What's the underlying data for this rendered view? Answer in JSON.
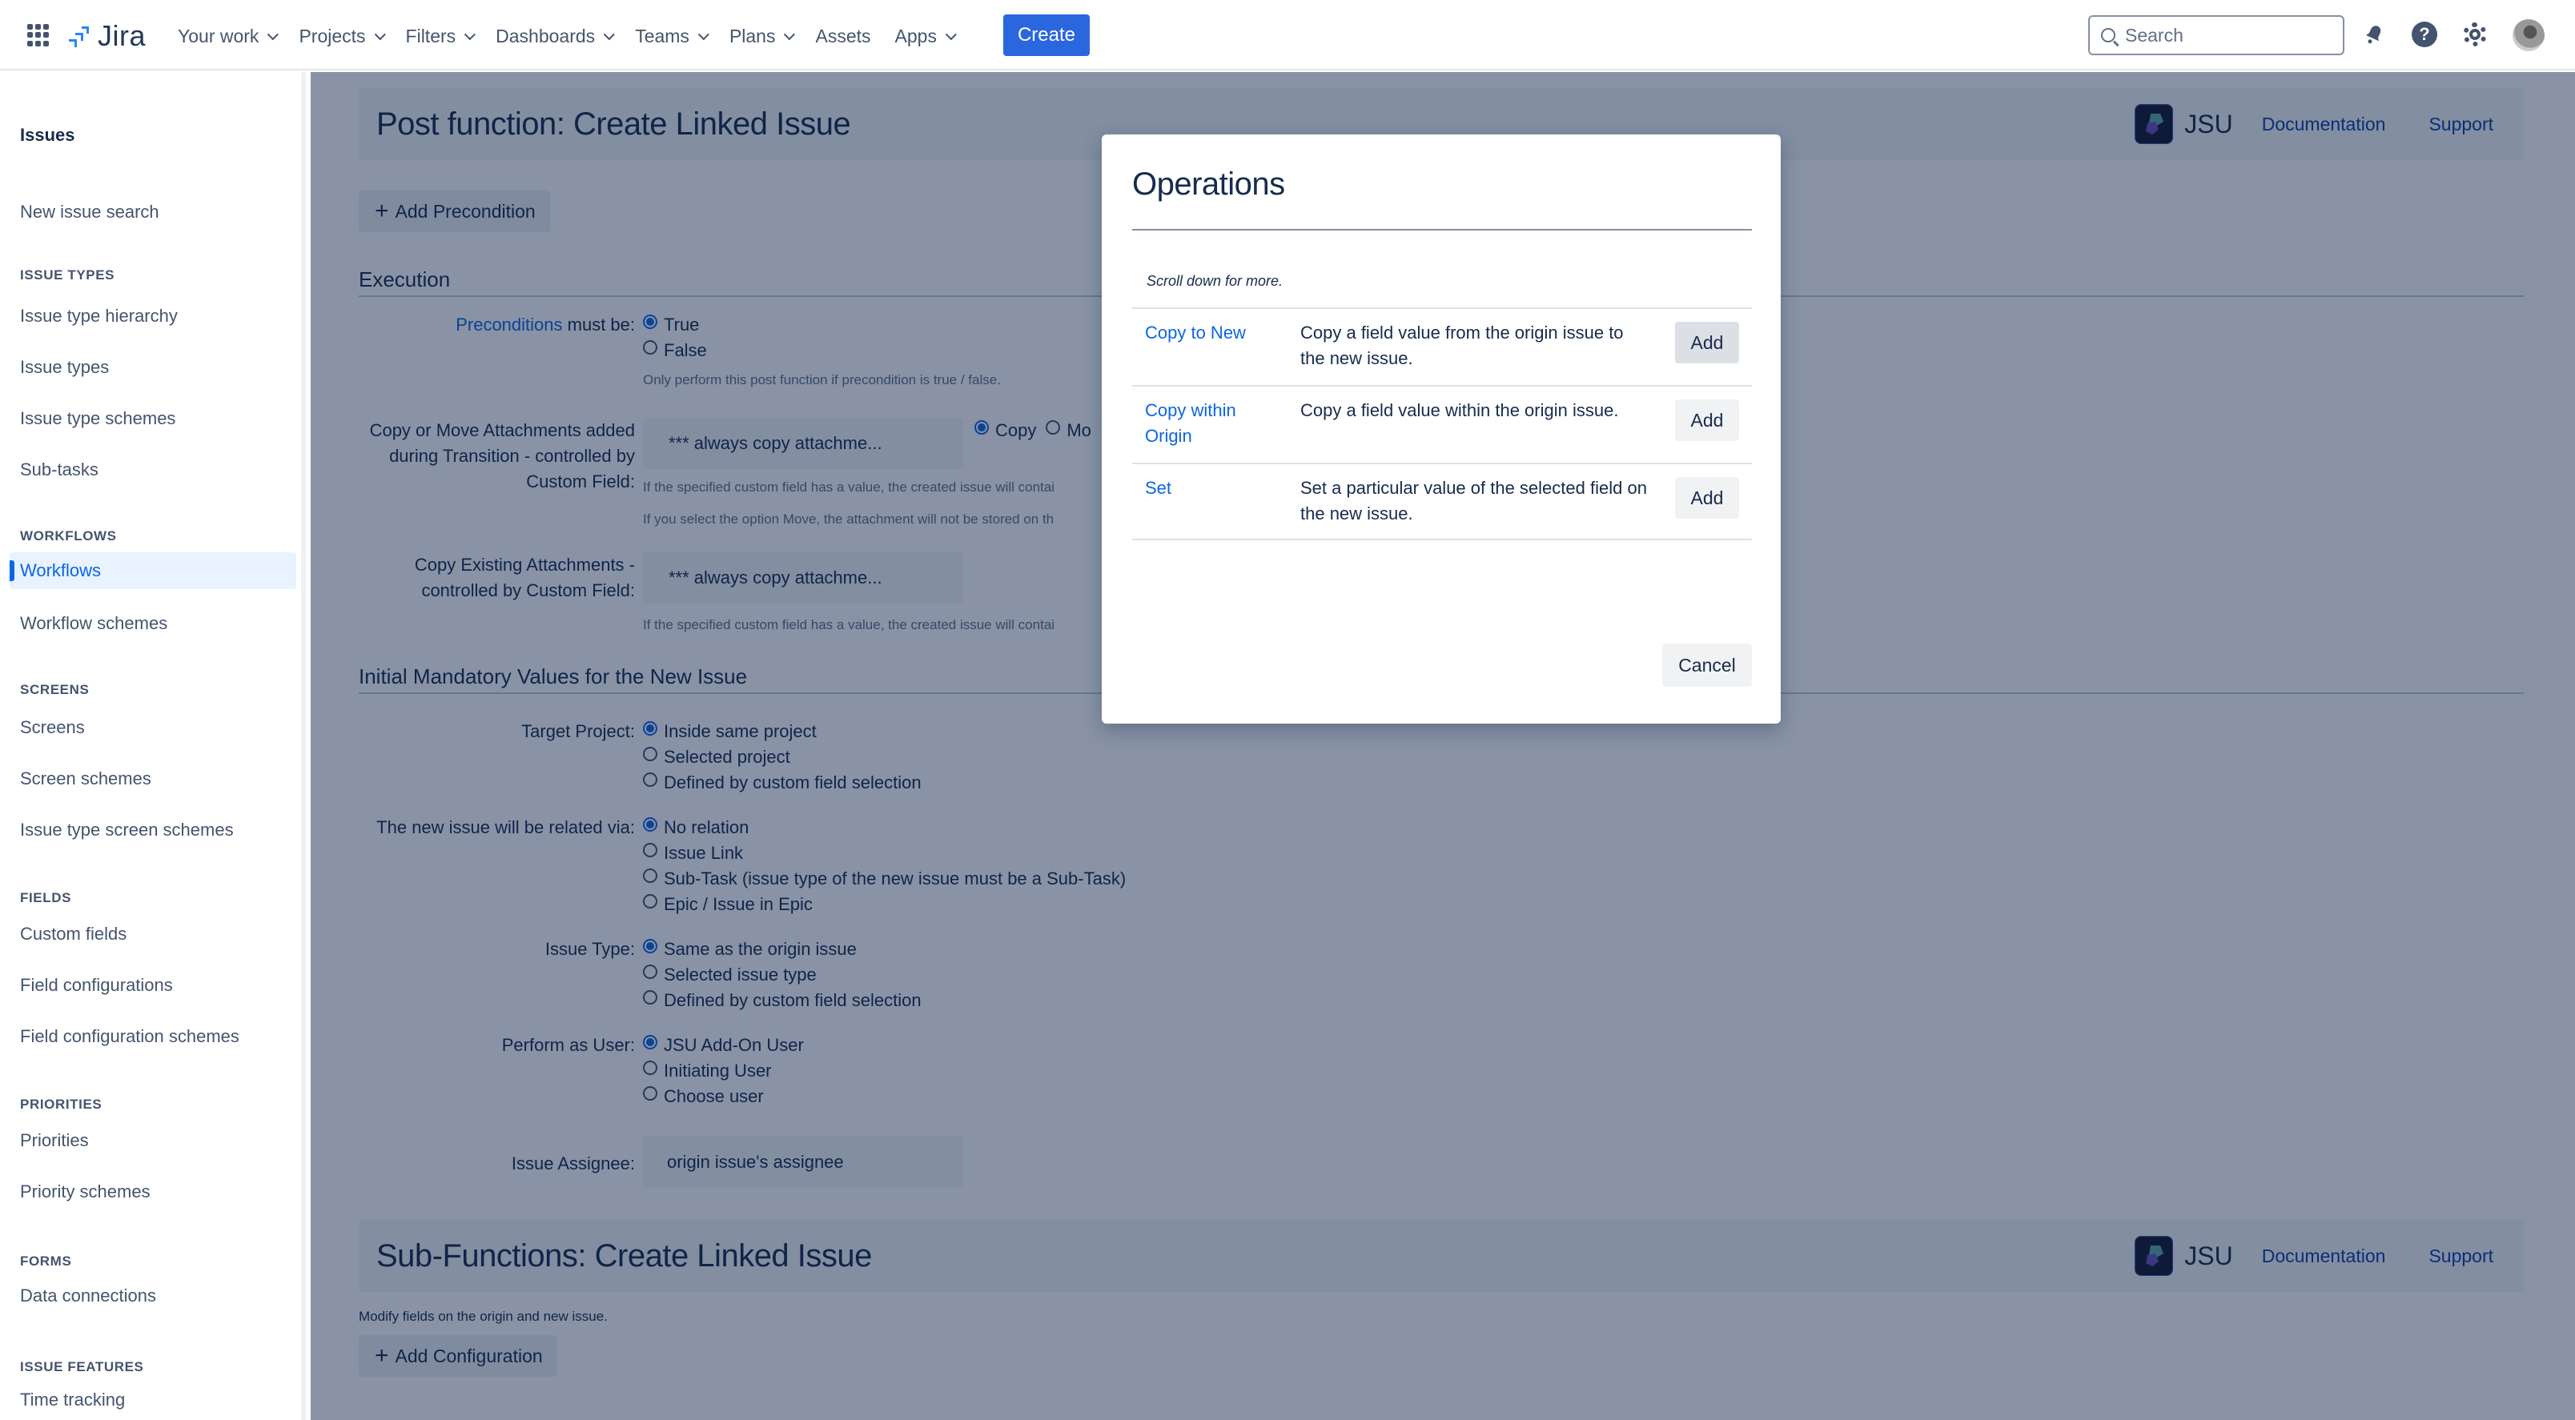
{
  "topnav": {
    "app_name": "Jira",
    "items": [
      {
        "label": "Your work",
        "dropdown": true
      },
      {
        "label": "Projects",
        "dropdown": true
      },
      {
        "label": "Filters",
        "dropdown": true
      },
      {
        "label": "Dashboards",
        "dropdown": true
      },
      {
        "label": "Teams",
        "dropdown": true
      },
      {
        "label": "Plans",
        "dropdown": true
      },
      {
        "label": "Assets",
        "dropdown": false
      },
      {
        "label": "Apps",
        "dropdown": true
      }
    ],
    "create_label": "Create",
    "search_placeholder": "Search",
    "icons": [
      "notifications-icon",
      "help-icon",
      "settings-icon",
      "avatar"
    ],
    "accent_color": "#2a66de"
  },
  "sidebar": {
    "title": "Issues",
    "top_item": "New issue search",
    "sections": [
      {
        "heading": "ISSUE TYPES",
        "items": [
          "Issue type hierarchy",
          "Issue types",
          "Issue type schemes",
          "Sub-tasks"
        ]
      },
      {
        "heading": "WORKFLOWS",
        "items": [
          "Workflows",
          "Workflow schemes"
        ],
        "active": "Workflows"
      },
      {
        "heading": "SCREENS",
        "items": [
          "Screens",
          "Screen schemes",
          "Issue type screen schemes"
        ]
      },
      {
        "heading": "FIELDS",
        "items": [
          "Custom fields",
          "Field configurations",
          "Field configuration schemes"
        ]
      },
      {
        "heading": "PRIORITIES",
        "items": [
          "Priorities",
          "Priority schemes"
        ]
      },
      {
        "heading": "FORMS",
        "items": [
          "Data connections"
        ]
      },
      {
        "heading": "ISSUE FEATURES",
        "items": [
          "Time tracking"
        ]
      }
    ]
  },
  "main": {
    "post_function": {
      "title": "Post function: Create Linked Issue",
      "brand": "JSU",
      "doc_link": "Documentation",
      "support_link": "Support",
      "add_precondition": "Add Precondition"
    },
    "execution": {
      "title": "Execution",
      "preconditions_link": "Preconditions",
      "preconditions_suffix": " must be:",
      "precondition_options": [
        {
          "label": "True",
          "checked": true
        },
        {
          "label": "False",
          "checked": false
        }
      ],
      "precondition_hint": "Only perform this post function if precondition is true / false.",
      "copy_move_label": "Copy or Move Attachments added during Transition - controlled by Custom Field:",
      "copy_move_value": "*** always copy attachme...",
      "copy_move_options": [
        {
          "label": "Copy",
          "checked": true
        },
        {
          "label": "Mo",
          "checked": false
        }
      ],
      "copy_move_hint1": "If the specified custom field has a value, the created issue will contai",
      "copy_move_hint2": "If you select the option Move, the attachment will not be stored on th",
      "copy_existing_label": "Copy Existing Attachments - controlled by Custom Field:",
      "copy_existing_value": "*** always copy attachme...",
      "copy_existing_hint": "If the specified custom field has a value, the created issue will contai"
    },
    "initial_values": {
      "title": "Initial Mandatory Values for the New Issue",
      "target_project": {
        "label": "Target Project:",
        "options": [
          {
            "label": "Inside same project",
            "checked": true
          },
          {
            "label": "Selected project",
            "checked": false
          },
          {
            "label": "Defined by custom field selection",
            "checked": false
          }
        ]
      },
      "related_via": {
        "label": "The new issue will be related via:",
        "options": [
          {
            "label": "No relation",
            "checked": true
          },
          {
            "label": "Issue Link",
            "checked": false
          },
          {
            "label": "Sub-Task (issue type of the new issue must be a Sub-Task)",
            "checked": false
          },
          {
            "label": "Epic / Issue in Epic",
            "checked": false
          }
        ]
      },
      "issue_type": {
        "label": "Issue Type:",
        "options": [
          {
            "label": "Same as the origin issue",
            "checked": true
          },
          {
            "label": "Selected issue type",
            "checked": false
          },
          {
            "label": "Defined by custom field selection",
            "checked": false
          }
        ]
      },
      "perform_as": {
        "label": "Perform as User:",
        "options": [
          {
            "label": "JSU Add-On User",
            "checked": true
          },
          {
            "label": "Initiating User",
            "checked": false
          },
          {
            "label": "Choose user",
            "checked": false
          }
        ]
      },
      "assignee": {
        "label": "Issue Assignee:",
        "value": "origin issue's assignee"
      }
    },
    "sub_functions": {
      "title": "Sub-Functions: Create Linked Issue",
      "brand": "JSU",
      "doc_link": "Documentation",
      "support_link": "Support",
      "description": "Modify fields on the origin and new issue.",
      "add_configuration": "Add Configuration"
    }
  },
  "modal": {
    "title": "Operations",
    "scroll_note": "Scroll down for more.",
    "operations": [
      {
        "name": "Copy to New",
        "description": "Copy a field value from the origin issue to the new issue.",
        "action": "Add"
      },
      {
        "name": "Copy within Origin",
        "description": "Copy a field value within the origin issue.",
        "action": "Add"
      },
      {
        "name": "Set",
        "description": "Set a particular value of the selected field on the new issue.",
        "action": "Add"
      }
    ],
    "cancel_label": "Cancel"
  }
}
